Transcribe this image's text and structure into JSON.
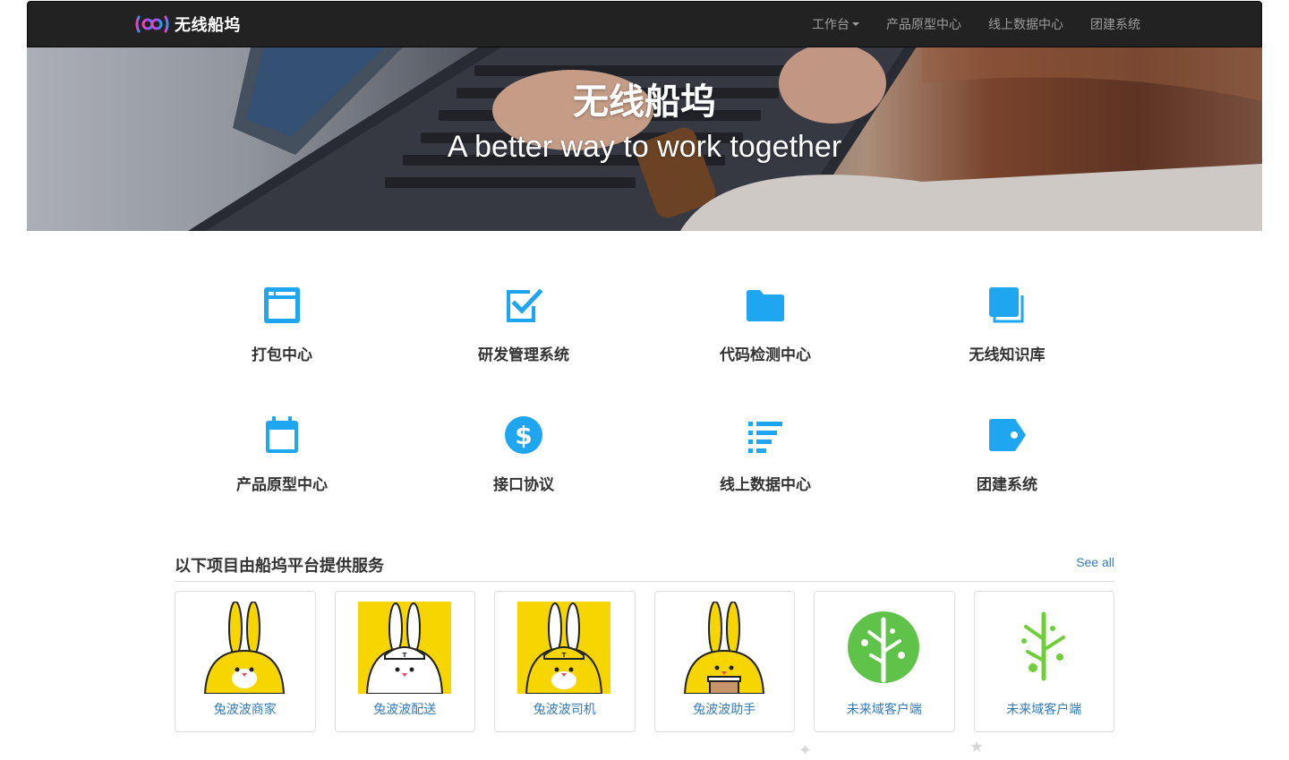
{
  "navbar": {
    "brand": "无线船坞",
    "items": [
      {
        "label": "工作台",
        "dropdown": true
      },
      {
        "label": "产品原型中心"
      },
      {
        "label": "线上数据中心"
      },
      {
        "label": "团建系统"
      }
    ]
  },
  "hero": {
    "title": "无线船坞",
    "subtitle": "A better way to work together"
  },
  "features": [
    {
      "label": "打包中心",
      "icon": "window-icon"
    },
    {
      "label": "研发管理系统",
      "icon": "checkbox-icon"
    },
    {
      "label": "代码检测中心",
      "icon": "folder-icon"
    },
    {
      "label": "无线知识库",
      "icon": "stacked-pages-icon"
    },
    {
      "label": "产品原型中心",
      "icon": "calendar-icon"
    },
    {
      "label": "接口协议",
      "icon": "dollar-circle-icon"
    },
    {
      "label": "线上数据中心",
      "icon": "list-icon"
    },
    {
      "label": "团建系统",
      "icon": "tag-icon"
    }
  ],
  "projects": {
    "title": "以下项目由船坞平台提供服务",
    "see_all": "See all",
    "cards": [
      {
        "label": "兔波波商家",
        "image": "rabbit-yellow"
      },
      {
        "label": "兔波波配送",
        "image": "rabbit-white-cap"
      },
      {
        "label": "兔波波司机",
        "image": "rabbit-yellow-cap"
      },
      {
        "label": "兔波波助手",
        "image": "rabbit-yellow-cup"
      },
      {
        "label": "未来域客户端",
        "image": "tree-circle-green"
      },
      {
        "label": "未来域客户端",
        "image": "tree-green"
      }
    ]
  },
  "colors": {
    "accent": "#1ea6f0",
    "link": "#337ab7",
    "navbar_bg": "#222222",
    "rabbit_yellow": "#f7d600",
    "tree_green": "#5fc34a"
  }
}
